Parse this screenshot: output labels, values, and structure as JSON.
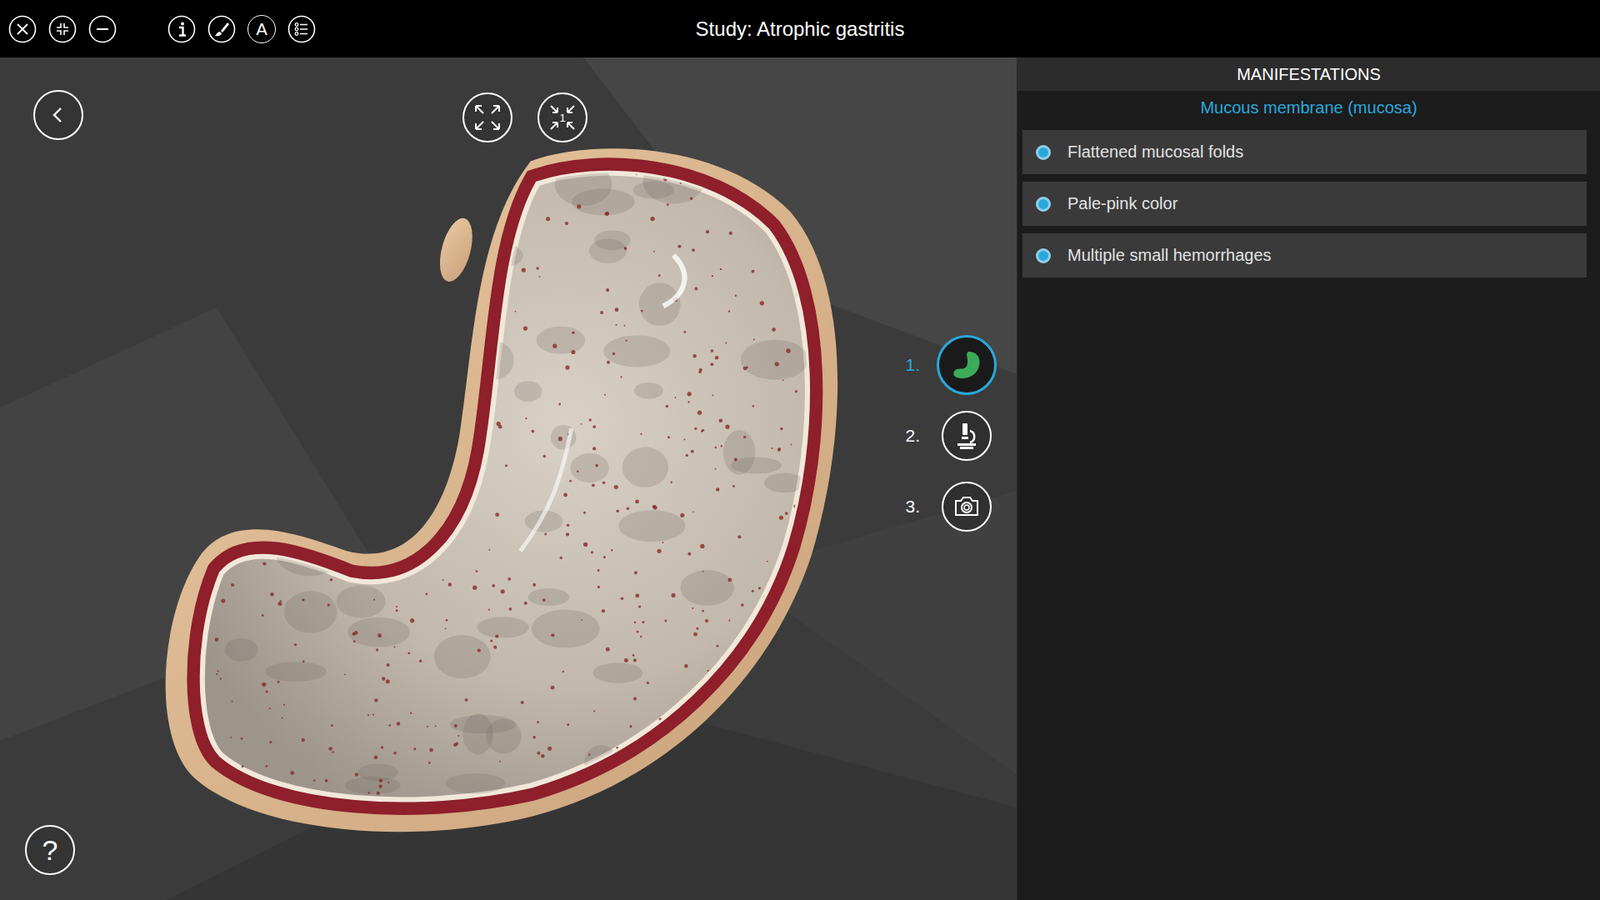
{
  "window": {
    "title": "Study: Atrophic gastritis"
  },
  "toolbar": {
    "font_button": "A"
  },
  "viewport": {
    "fit_one_label": "1",
    "help": "?",
    "views": [
      {
        "number": "1.",
        "kind": "model",
        "selected": true
      },
      {
        "number": "2.",
        "kind": "microscope",
        "selected": false
      },
      {
        "number": "3.",
        "kind": "photo",
        "selected": false
      }
    ]
  },
  "panel": {
    "title": "MANIFESTATIONS",
    "section": "Mucous membrane (mucosa)",
    "items": [
      {
        "label": "Flattened mucosal folds",
        "on": true
      },
      {
        "label": "Pale-pink color",
        "on": true
      },
      {
        "label": "Multiple small hemorrhages",
        "on": true
      }
    ]
  }
}
